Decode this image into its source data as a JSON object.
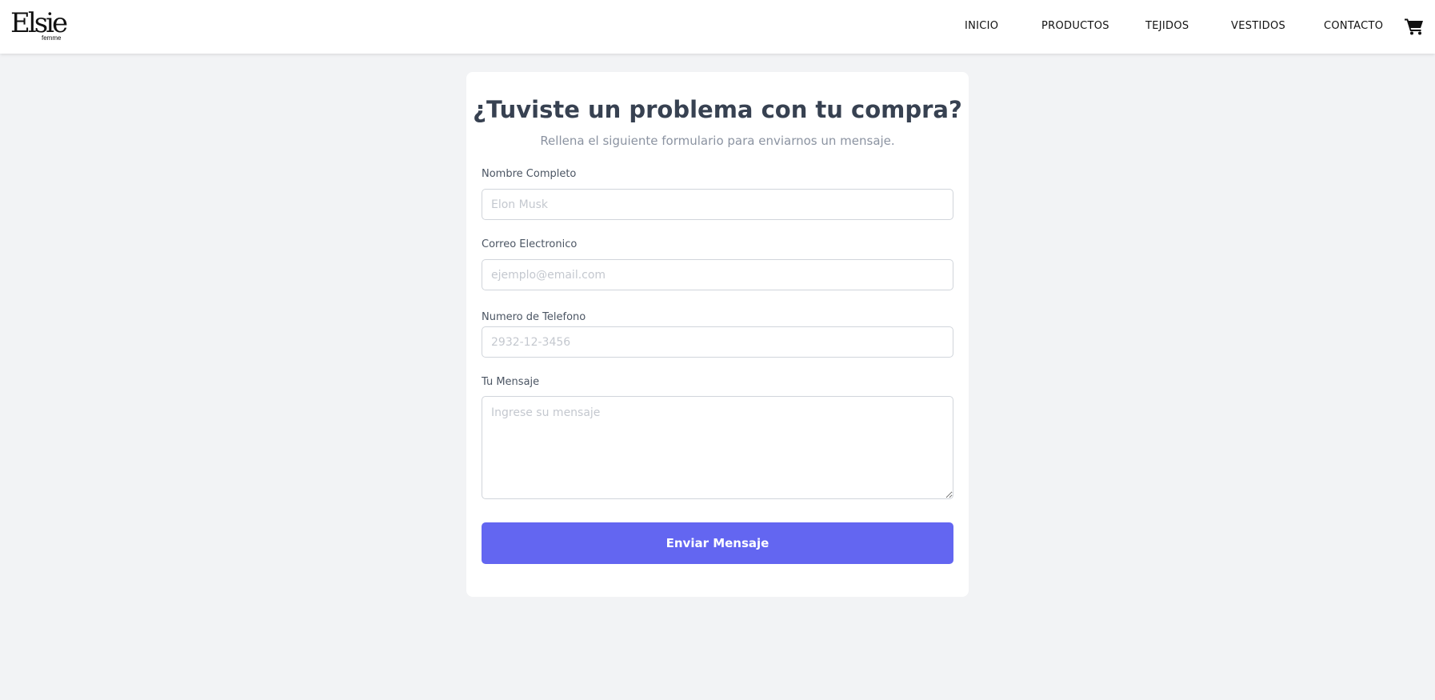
{
  "brand": {
    "logo_main": "Elsie",
    "logo_sub": "femme"
  },
  "nav": {
    "items": [
      {
        "label": "INICIO"
      },
      {
        "label": "PRODUCTOS"
      },
      {
        "label": "TEJIDOS"
      },
      {
        "label": "VESTIDOS"
      },
      {
        "label": "CONTACTO"
      }
    ],
    "cart_icon": "cart-icon"
  },
  "form": {
    "title": "¿Tuviste un problema con tu compra?",
    "subtitle": "Rellena el siguiente formulario para enviarnos un mensaje.",
    "name": {
      "label": "Nombre Completo",
      "placeholder": "Elon Musk",
      "value": ""
    },
    "email": {
      "label": "Correo Electronico",
      "placeholder": "ejemplo@email.com",
      "value": ""
    },
    "phone": {
      "label": "Numero de Telefono",
      "placeholder": "2932-12-3456",
      "value": ""
    },
    "message": {
      "label": "Tu Mensaje",
      "placeholder": "Ingrese su mensaje",
      "value": ""
    },
    "submit_label": "Enviar Mensaje"
  },
  "colors": {
    "accent": "#6366f1",
    "page_background": "#f2f3f5",
    "heading": "#374151"
  }
}
